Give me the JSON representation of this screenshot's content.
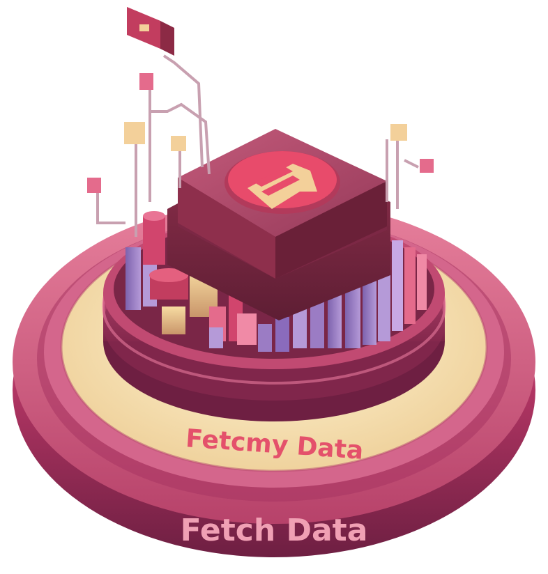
{
  "inner_ring_label": "Fetcmy Data",
  "outer_ring_label": "Fetch Data",
  "colors": {
    "base_dark": "#8a2a52",
    "base_mid": "#c23d6b",
    "base_light": "#e46b8c",
    "cream": "#f7e3b3",
    "purple": "#9b7cc4",
    "block": "#a23a4f",
    "emblem": "#e84b6b",
    "emblem_arrow": "#f3d09a",
    "label_text": "#e4516b"
  }
}
